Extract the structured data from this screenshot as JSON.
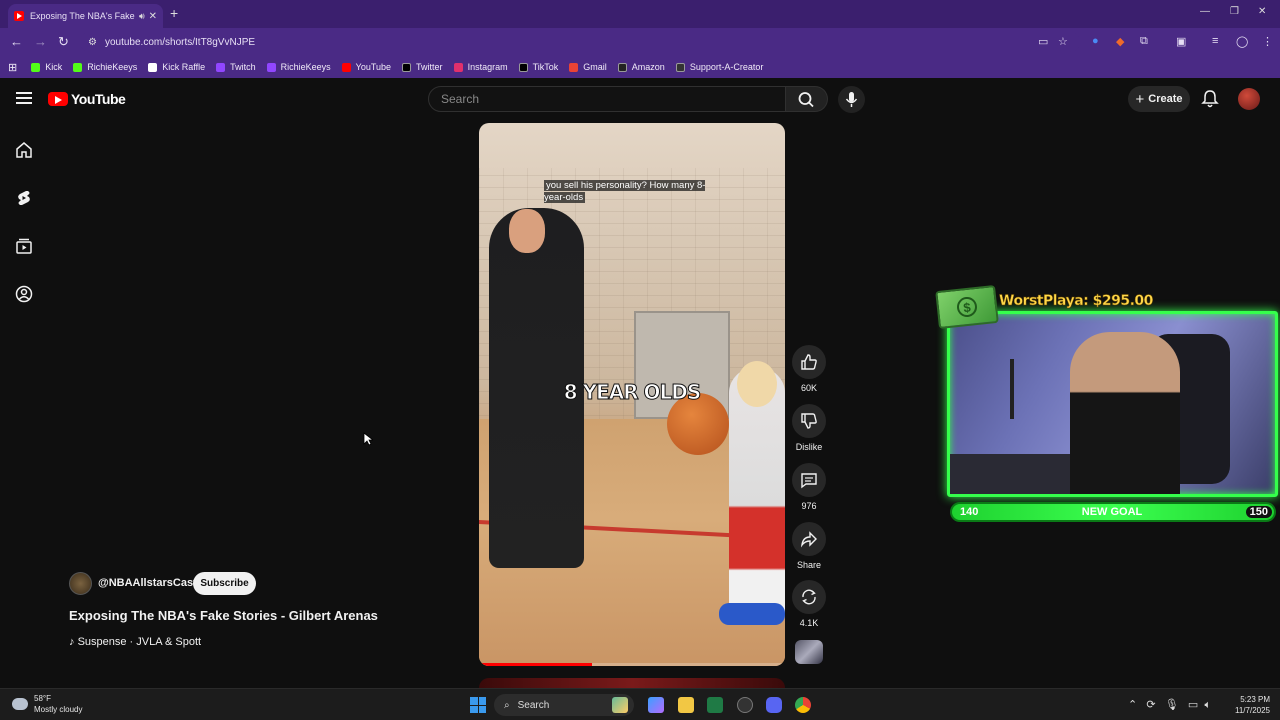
{
  "browser": {
    "tab_title": "Exposing The NBA's Fake S",
    "url": "youtube.com/shorts/ItT8gVvNJPE",
    "bookmarks": [
      {
        "label": "Kick",
        "color": "#53fc18"
      },
      {
        "label": "RichieKeeys",
        "color": "#53fc18"
      },
      {
        "label": "Kick Raffle",
        "color": "#ffffff"
      },
      {
        "label": "Twitch",
        "color": "#9146ff"
      },
      {
        "label": "RichieKeeys",
        "color": "#9146ff"
      },
      {
        "label": "YouTube",
        "color": "#ff0000"
      },
      {
        "label": "Twitter",
        "color": "#000000"
      },
      {
        "label": "Instagram",
        "color": "#e1306c"
      },
      {
        "label": "TikTok",
        "color": "#000000"
      },
      {
        "label": "Gmail",
        "color": "#ea4335"
      },
      {
        "label": "Amazon",
        "color": "#222222"
      },
      {
        "label": "Support-A-Creator",
        "color": "#333333"
      }
    ]
  },
  "youtube": {
    "logo_text": "YouTube",
    "search_placeholder": "Search",
    "create_label": "Create",
    "short": {
      "caption": "you sell his personality? How many 8-year-olds",
      "overlay_text": "8 YEAR OLDS",
      "progress_fraction": 0.37
    },
    "actions": {
      "likes": "60K",
      "dislike_label": "Dislike",
      "comments": "976",
      "share_label": "Share",
      "remixes": "4.1K"
    },
    "channel": {
      "handle": "@NBAAllstarsCast",
      "subscribe_label": "Subscribe"
    },
    "video_title": "Exposing The NBA's Fake Stories - Gilbert Arenas",
    "music": "Suspense · JVLA & Spott"
  },
  "stream_overlay": {
    "donation": "WorstPlaya: $295.00",
    "goal_current": "140",
    "goal_label": "NEW GOAL",
    "goal_target": "150",
    "goal_fraction": 0.93,
    "accent": "#35ff4c"
  },
  "taskbar": {
    "weather_temp": "58°F",
    "weather_desc": "Mostly cloudy",
    "search_label": "Search",
    "time": "5:23 PM",
    "date": "11/7/2025"
  }
}
